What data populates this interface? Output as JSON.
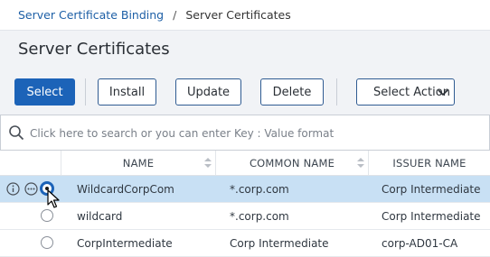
{
  "breadcrumb": {
    "parent": "Server Certificate Binding",
    "separator": "/",
    "current": "Server Certificates"
  },
  "page": {
    "title": "Server Certificates"
  },
  "toolbar": {
    "select": "Select",
    "install": "Install",
    "update": "Update",
    "delete": "Delete",
    "select_action": "Select Action"
  },
  "search": {
    "placeholder": "Click here to search or you can enter Key : Value format"
  },
  "table": {
    "columns": [
      "NAME",
      "COMMON NAME",
      "ISSUER NAME"
    ],
    "rows": [
      {
        "name": "WildcardCorpCom",
        "common_name": "*.corp.com",
        "issuer": "Corp Intermediate",
        "selected": true
      },
      {
        "name": "wildcard",
        "common_name": "*.corp.com",
        "issuer": "Corp Intermediate",
        "selected": false
      },
      {
        "name": "CorpIntermediate",
        "common_name": "Corp Intermediate",
        "issuer": "corp-AD01-CA",
        "selected": false
      }
    ]
  },
  "colors": {
    "accent": "#1c63b8",
    "link": "#1d5fa6",
    "selected_row": "#c8e0f4",
    "band": "#f1f3f6"
  }
}
